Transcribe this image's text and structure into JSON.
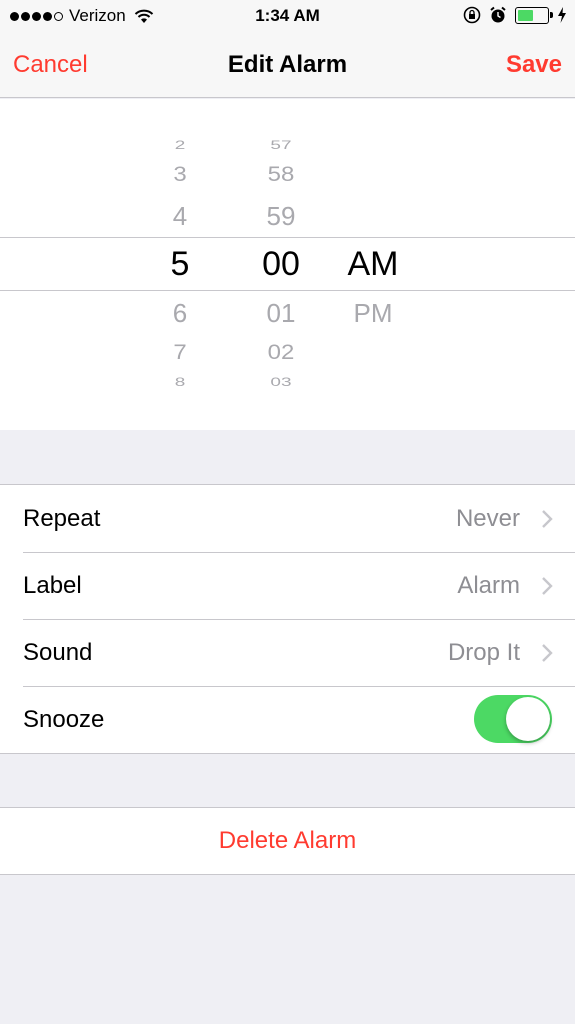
{
  "status_bar": {
    "carrier": "Verizon",
    "time": "1:34 AM",
    "signal_bars_filled": 4,
    "signal_bars_total": 5,
    "battery_level": 0.55,
    "icons": [
      "wifi-icon",
      "rotation-lock-icon",
      "alarm-clock-icon",
      "battery-icon",
      "charging-bolt-icon"
    ]
  },
  "nav": {
    "cancel_label": "Cancel",
    "title": "Edit Alarm",
    "save_label": "Save"
  },
  "picker": {
    "hours": [
      "2",
      "3",
      "4",
      "5",
      "6",
      "7",
      "8"
    ],
    "minutes": [
      "57",
      "58",
      "59",
      "00",
      "01",
      "02",
      "03"
    ],
    "periods": [
      "AM",
      "PM"
    ],
    "selected_hour": "5",
    "selected_minute": "00",
    "selected_period": "AM"
  },
  "settings": {
    "rows": [
      {
        "label": "Repeat",
        "value": "Never"
      },
      {
        "label": "Label",
        "value": "Alarm"
      },
      {
        "label": "Sound",
        "value": "Drop It"
      },
      {
        "label": "Snooze",
        "toggle_on": true
      }
    ]
  },
  "delete": {
    "label": "Delete Alarm"
  },
  "colors": {
    "accent": "#ff3b30",
    "toggle_on": "#4cd964",
    "secondary_text": "#8e8e93",
    "picker_dim": "#a9a9ae",
    "background": "#efeff4"
  }
}
